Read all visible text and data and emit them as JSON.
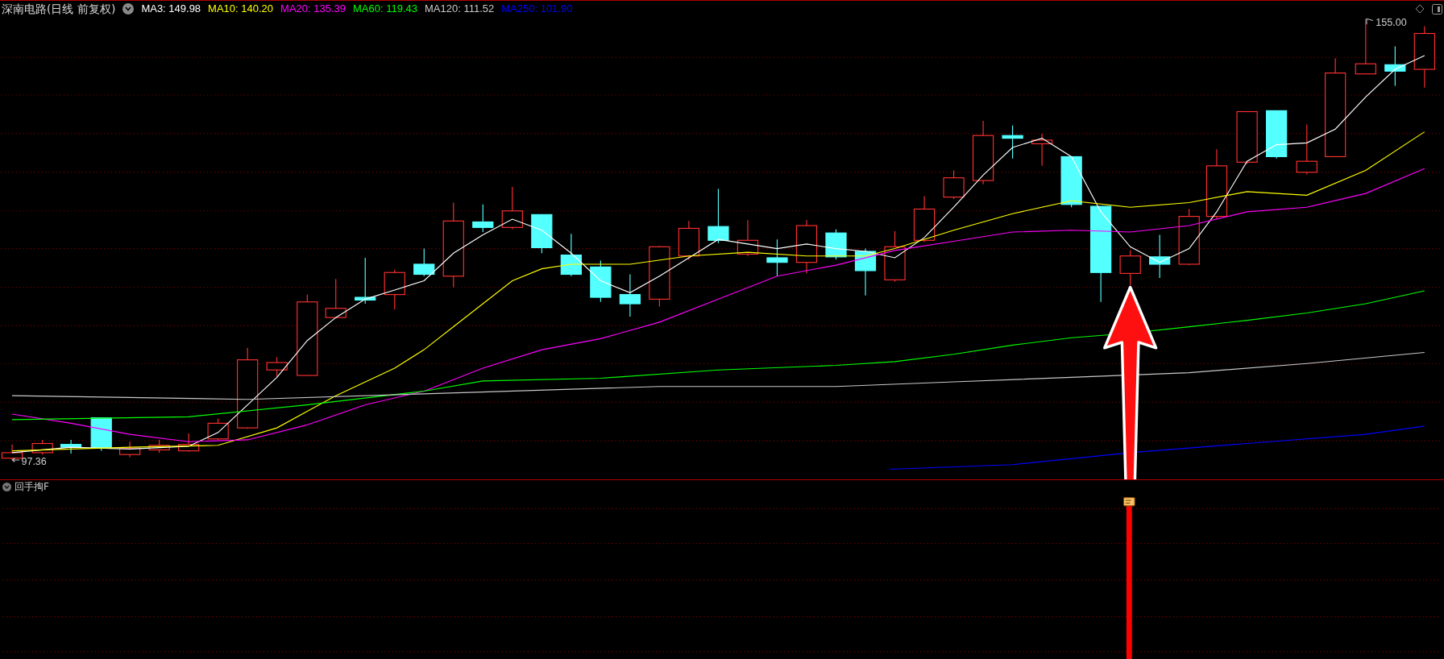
{
  "header": {
    "title": "深南电路(日线 前复权)",
    "indicators": [
      {
        "text": "MA3: 149.98",
        "color": "#ffffff"
      },
      {
        "text": "MA10: 140.20",
        "color": "#ffff00"
      },
      {
        "text": "MA20: 135.39",
        "color": "#ff00ff"
      },
      {
        "text": "MA60: 119.43",
        "color": "#00ff00"
      },
      {
        "text": "MA120: 111.52",
        "color": "#c8c8c8"
      },
      {
        "text": "MA250: 101.90",
        "color": "#0000ff"
      }
    ]
  },
  "main_chart": {
    "high_label": "155.00",
    "low_label": "97.36"
  },
  "indicator_panel": {
    "title": "回手掏F"
  }
}
